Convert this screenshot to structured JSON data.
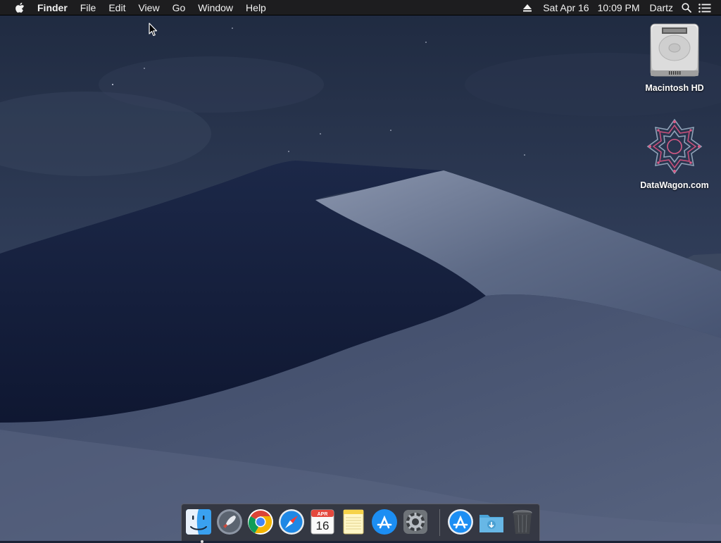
{
  "menubar": {
    "apple_icon": "apple-icon",
    "app_name": "Finder",
    "menus": [
      "File",
      "Edit",
      "View",
      "Go",
      "Window",
      "Help"
    ],
    "date": "Sat Apr 16",
    "time": "10:09 PM",
    "user": "Dartz",
    "status_icons": [
      "eject-icon",
      "search-icon",
      "list-icon"
    ]
  },
  "desktop": {
    "icons": [
      {
        "label": "Macintosh HD",
        "icon": "hard-drive-icon"
      },
      {
        "label": "DataWagon.com",
        "icon": "network-volume-icon"
      }
    ]
  },
  "dock": {
    "apps": [
      {
        "icon": "finder-icon",
        "running": true
      },
      {
        "icon": "launchpad-icon",
        "running": false
      },
      {
        "icon": "chrome-icon",
        "running": false
      },
      {
        "icon": "safari-icon",
        "running": false
      },
      {
        "icon": "calendar-icon",
        "month": "APR",
        "day": "16",
        "running": false
      },
      {
        "icon": "notes-icon",
        "running": false
      },
      {
        "icon": "app-store-icon",
        "running": false
      },
      {
        "icon": "system-preferences-icon",
        "running": false
      },
      {
        "icon": "applications-folder-icon",
        "running": false
      },
      {
        "icon": "downloads-folder-icon",
        "running": false
      },
      {
        "icon": "trash-icon",
        "running": false
      }
    ]
  },
  "colors": {
    "menubar": "#1d1d1f",
    "sky_top": "#243047",
    "sky_bottom": "#3b4a66",
    "dune_shadow": "#0f1730",
    "dune_light": "#7d8aa5"
  }
}
